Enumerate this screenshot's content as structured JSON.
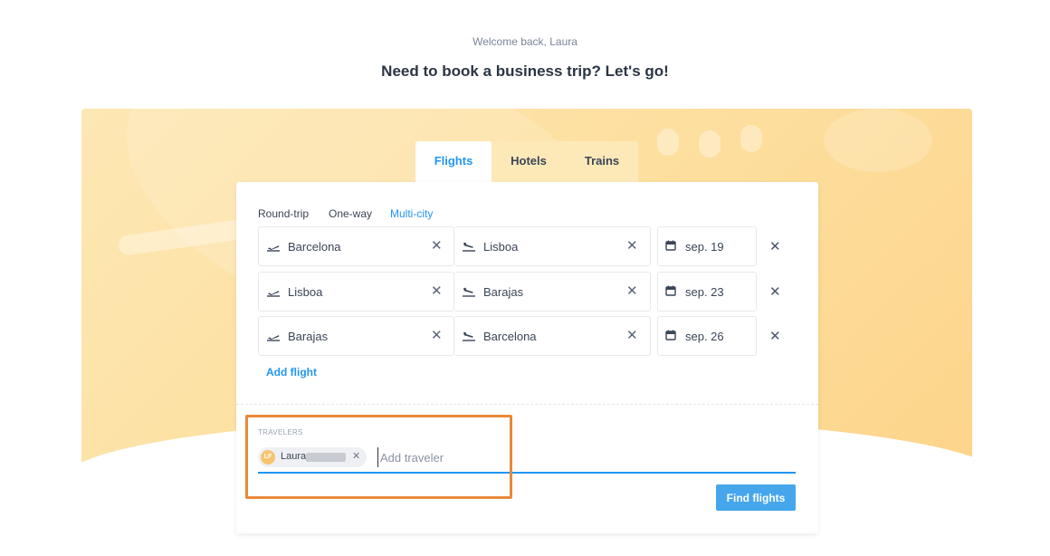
{
  "header": {
    "welcome": "Welcome back, Laura",
    "headline": "Need to book a business trip? Let's go!"
  },
  "tabs": [
    {
      "label": "Flights",
      "active": true
    },
    {
      "label": "Hotels",
      "active": false
    },
    {
      "label": "Trains",
      "active": false
    }
  ],
  "trip_types": [
    {
      "label": "Round-trip",
      "active": false
    },
    {
      "label": "One-way",
      "active": false
    },
    {
      "label": "Multi-city",
      "active": true
    }
  ],
  "flights": [
    {
      "from": "Barcelona",
      "to": "Lisboa",
      "date": "sep. 19"
    },
    {
      "from": "Lisboa",
      "to": "Barajas",
      "date": "sep. 23"
    },
    {
      "from": "Barajas",
      "to": "Barcelona",
      "date": "sep. 26"
    }
  ],
  "add_flight_label": "Add flight",
  "travelers": {
    "label": "TRAVELERS",
    "chip_initials": "LF",
    "chip_name": "Laura",
    "input_placeholder": "Add traveler"
  },
  "find_button_label": "Find flights",
  "icons": {
    "departure": "plane-takeoff-icon",
    "arrival": "plane-landing-icon",
    "date": "calendar-icon",
    "clear": "close-icon"
  },
  "colors": {
    "accent": "#2196f3",
    "button": "#45a6ec",
    "banner": "#fde0a1",
    "highlight": "#e8893a"
  }
}
